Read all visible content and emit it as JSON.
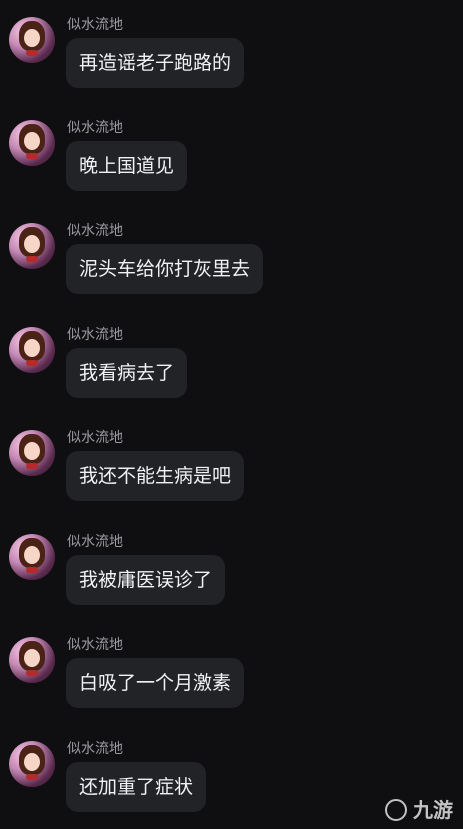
{
  "messages": [
    {
      "sender": "似水流地",
      "text": "再造谣老子跑路的"
    },
    {
      "sender": "似水流地",
      "text": "晚上国道见"
    },
    {
      "sender": "似水流地",
      "text": "泥头车给你打灰里去"
    },
    {
      "sender": "似水流地",
      "text": "我看病去了"
    },
    {
      "sender": "似水流地",
      "text": "我还不能生病是吧"
    },
    {
      "sender": "似水流地",
      "text": "我被庸医误诊了"
    },
    {
      "sender": "似水流地",
      "text": "白吸了一个月激素"
    },
    {
      "sender": "似水流地",
      "text": "还加重了症状"
    }
  ],
  "watermark": {
    "text": "九游"
  }
}
